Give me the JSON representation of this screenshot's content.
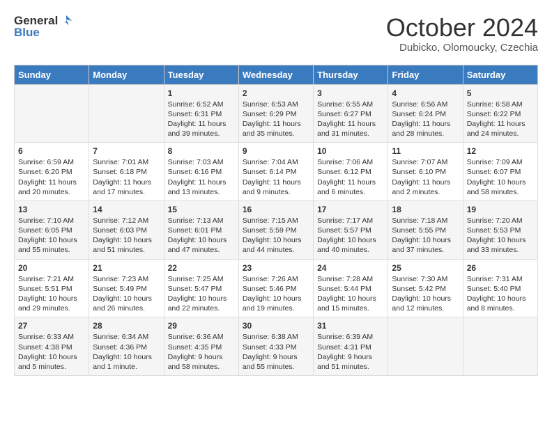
{
  "logo": {
    "general": "General",
    "blue": "Blue"
  },
  "title": "October 2024",
  "subtitle": "Dubicko, Olomoucky, Czechia",
  "weekdays": [
    "Sunday",
    "Monday",
    "Tuesday",
    "Wednesday",
    "Thursday",
    "Friday",
    "Saturday"
  ],
  "weeks": [
    [
      {
        "day": "",
        "content": ""
      },
      {
        "day": "",
        "content": ""
      },
      {
        "day": "1",
        "content": "Sunrise: 6:52 AM\nSunset: 6:31 PM\nDaylight: 11 hours and 39 minutes."
      },
      {
        "day": "2",
        "content": "Sunrise: 6:53 AM\nSunset: 6:29 PM\nDaylight: 11 hours and 35 minutes."
      },
      {
        "day": "3",
        "content": "Sunrise: 6:55 AM\nSunset: 6:27 PM\nDaylight: 11 hours and 31 minutes."
      },
      {
        "day": "4",
        "content": "Sunrise: 6:56 AM\nSunset: 6:24 PM\nDaylight: 11 hours and 28 minutes."
      },
      {
        "day": "5",
        "content": "Sunrise: 6:58 AM\nSunset: 6:22 PM\nDaylight: 11 hours and 24 minutes."
      }
    ],
    [
      {
        "day": "6",
        "content": "Sunrise: 6:59 AM\nSunset: 6:20 PM\nDaylight: 11 hours and 20 minutes."
      },
      {
        "day": "7",
        "content": "Sunrise: 7:01 AM\nSunset: 6:18 PM\nDaylight: 11 hours and 17 minutes."
      },
      {
        "day": "8",
        "content": "Sunrise: 7:03 AM\nSunset: 6:16 PM\nDaylight: 11 hours and 13 minutes."
      },
      {
        "day": "9",
        "content": "Sunrise: 7:04 AM\nSunset: 6:14 PM\nDaylight: 11 hours and 9 minutes."
      },
      {
        "day": "10",
        "content": "Sunrise: 7:06 AM\nSunset: 6:12 PM\nDaylight: 11 hours and 6 minutes."
      },
      {
        "day": "11",
        "content": "Sunrise: 7:07 AM\nSunset: 6:10 PM\nDaylight: 11 hours and 2 minutes."
      },
      {
        "day": "12",
        "content": "Sunrise: 7:09 AM\nSunset: 6:07 PM\nDaylight: 10 hours and 58 minutes."
      }
    ],
    [
      {
        "day": "13",
        "content": "Sunrise: 7:10 AM\nSunset: 6:05 PM\nDaylight: 10 hours and 55 minutes."
      },
      {
        "day": "14",
        "content": "Sunrise: 7:12 AM\nSunset: 6:03 PM\nDaylight: 10 hours and 51 minutes."
      },
      {
        "day": "15",
        "content": "Sunrise: 7:13 AM\nSunset: 6:01 PM\nDaylight: 10 hours and 47 minutes."
      },
      {
        "day": "16",
        "content": "Sunrise: 7:15 AM\nSunset: 5:59 PM\nDaylight: 10 hours and 44 minutes."
      },
      {
        "day": "17",
        "content": "Sunrise: 7:17 AM\nSunset: 5:57 PM\nDaylight: 10 hours and 40 minutes."
      },
      {
        "day": "18",
        "content": "Sunrise: 7:18 AM\nSunset: 5:55 PM\nDaylight: 10 hours and 37 minutes."
      },
      {
        "day": "19",
        "content": "Sunrise: 7:20 AM\nSunset: 5:53 PM\nDaylight: 10 hours and 33 minutes."
      }
    ],
    [
      {
        "day": "20",
        "content": "Sunrise: 7:21 AM\nSunset: 5:51 PM\nDaylight: 10 hours and 29 minutes."
      },
      {
        "day": "21",
        "content": "Sunrise: 7:23 AM\nSunset: 5:49 PM\nDaylight: 10 hours and 26 minutes."
      },
      {
        "day": "22",
        "content": "Sunrise: 7:25 AM\nSunset: 5:47 PM\nDaylight: 10 hours and 22 minutes."
      },
      {
        "day": "23",
        "content": "Sunrise: 7:26 AM\nSunset: 5:46 PM\nDaylight: 10 hours and 19 minutes."
      },
      {
        "day": "24",
        "content": "Sunrise: 7:28 AM\nSunset: 5:44 PM\nDaylight: 10 hours and 15 minutes."
      },
      {
        "day": "25",
        "content": "Sunrise: 7:30 AM\nSunset: 5:42 PM\nDaylight: 10 hours and 12 minutes."
      },
      {
        "day": "26",
        "content": "Sunrise: 7:31 AM\nSunset: 5:40 PM\nDaylight: 10 hours and 8 minutes."
      }
    ],
    [
      {
        "day": "27",
        "content": "Sunrise: 6:33 AM\nSunset: 4:38 PM\nDaylight: 10 hours and 5 minutes."
      },
      {
        "day": "28",
        "content": "Sunrise: 6:34 AM\nSunset: 4:36 PM\nDaylight: 10 hours and 1 minute."
      },
      {
        "day": "29",
        "content": "Sunrise: 6:36 AM\nSunset: 4:35 PM\nDaylight: 9 hours and 58 minutes."
      },
      {
        "day": "30",
        "content": "Sunrise: 6:38 AM\nSunset: 4:33 PM\nDaylight: 9 hours and 55 minutes."
      },
      {
        "day": "31",
        "content": "Sunrise: 6:39 AM\nSunset: 4:31 PM\nDaylight: 9 hours and 51 minutes."
      },
      {
        "day": "",
        "content": ""
      },
      {
        "day": "",
        "content": ""
      }
    ]
  ]
}
